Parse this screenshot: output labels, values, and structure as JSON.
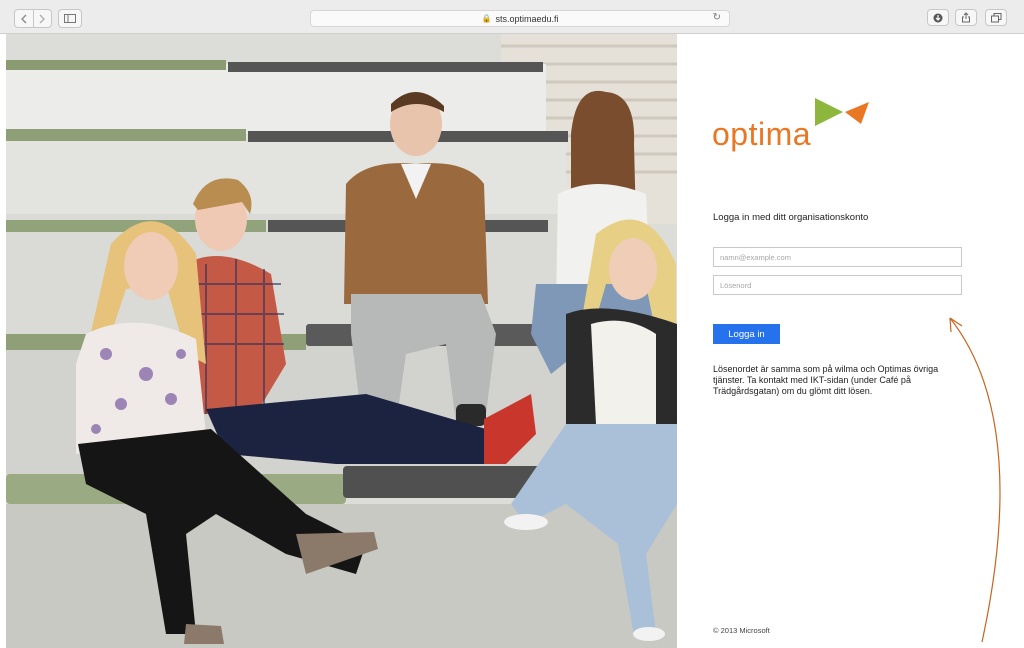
{
  "browser": {
    "url": "sts.optimaedu.fi",
    "back_icon": "chevron-left-icon",
    "forward_icon": "chevron-right-icon",
    "sidebar_icon": "sidebar-icon",
    "reload_icon": "reload-icon",
    "download_icon": "download-icon",
    "share_icon": "share-icon",
    "tabs_icon": "tabs-icon"
  },
  "logo": {
    "text": "optima",
    "colors": {
      "text": "#ea7723",
      "green": "#8cb63c",
      "orange": "#ea7723"
    }
  },
  "login": {
    "heading": "Logga in med ditt organisationskonto",
    "username_placeholder": "namn@example.com",
    "password_placeholder": "Lösenord",
    "button_label": "Logga in",
    "button_color": "#2672ec",
    "info_text": "Lösenordet är samma som på wilma och Optimas övriga tjänster. Ta kontakt med IKT-sidan (under Café på Trädgårdsgatan) om du glömt ditt lösen."
  },
  "footer": {
    "copyright": "© 2013 Microsoft"
  }
}
